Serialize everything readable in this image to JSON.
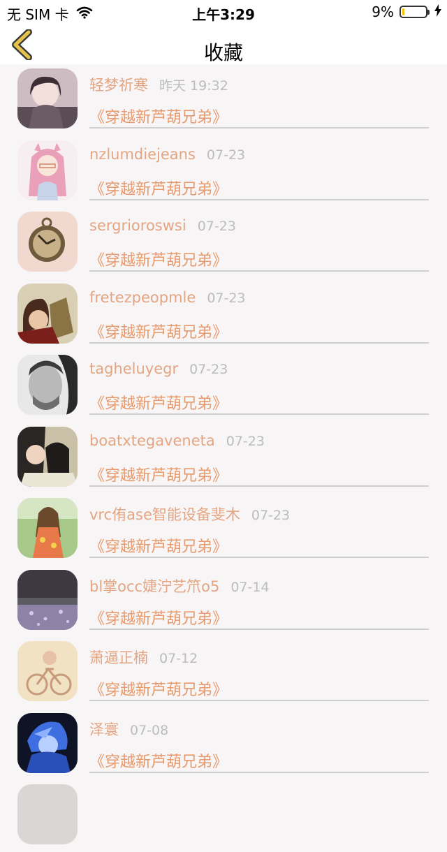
{
  "status_bar": {
    "carrier": "无 SIM 卡",
    "time": "上午3:29",
    "battery_percent": "9%",
    "battery_level": 0.09,
    "battery_color": "#f2c200",
    "icons": [
      "wifi-icon",
      "charging-icon"
    ]
  },
  "nav": {
    "title": "收藏",
    "back_icon": "chevron-left-icon",
    "back_color": "#e6c34a"
  },
  "colors": {
    "name": "#e4a582",
    "time": "#bcbcbc",
    "book": "#e79a6d",
    "divider": "#cfcfcf"
  },
  "items": [
    {
      "name": "轻梦祈寒",
      "time": "昨天 19:32",
      "book": "《穿越新芦葫兄弟》",
      "avatar": "anime-girl-hoodie"
    },
    {
      "name": "nzlumdiejeans",
      "time": "07-23",
      "book": "《穿越新芦葫兄弟》",
      "avatar": "pink-hair-girl"
    },
    {
      "name": "sergrioroswsi",
      "time": "07-23",
      "book": "《穿越新芦葫兄弟》",
      "avatar": "pocket-watch"
    },
    {
      "name": "fretezpeopmle",
      "time": "07-23",
      "book": "《穿越新芦葫兄弟》",
      "avatar": "anime-boy-fox"
    },
    {
      "name": "tagheluyegr",
      "time": "07-23",
      "book": "《穿越新芦葫兄弟》",
      "avatar": "bw-man-portrait"
    },
    {
      "name": "boatxtegaveneta",
      "time": "07-23",
      "book": "《穿越新芦葫兄弟》",
      "avatar": "two-girls-selfie"
    },
    {
      "name": "vrc侑ase智能设备斐木",
      "time": "07-23",
      "book": "《穿越新芦葫兄弟》",
      "avatar": "girl-flowers"
    },
    {
      "name": "bl掌occ婕泞艺笊o5",
      "time": "07-14",
      "book": "《穿越新芦葫兄弟》",
      "avatar": "purple-sparkles"
    },
    {
      "name": "萧逼正楠",
      "time": "07-12",
      "book": "《穿越新芦葫兄弟》",
      "avatar": "bicycle-sepia"
    },
    {
      "name": "泽寰",
      "time": "07-08",
      "book": "《穿越新芦葫兄弟》",
      "avatar": "blue-anime-boy"
    }
  ]
}
